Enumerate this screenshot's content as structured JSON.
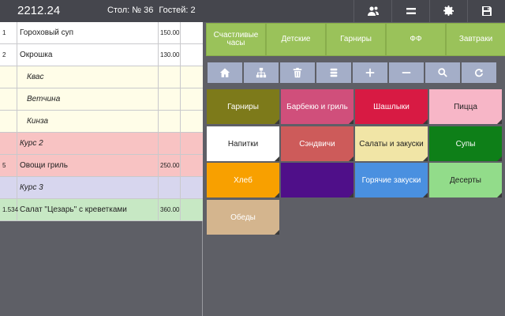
{
  "header": {
    "order_number": "2212.24",
    "table": "Стол: № 36",
    "guests": "Гостей: 2",
    "buttons": [
      {
        "icon": "users-icon"
      },
      {
        "icon": "equals-icon"
      },
      {
        "icon": "gear-icon"
      },
      {
        "icon": "save-icon"
      }
    ]
  },
  "order_rows": [
    {
      "type": "dish",
      "num": "1",
      "name": "Гороховый суп",
      "price": "150.00"
    },
    {
      "type": "dish",
      "num": "2",
      "name": "Окрошка",
      "price": "130.00"
    },
    {
      "type": "mod",
      "num": "",
      "name": "Квас",
      "price": ""
    },
    {
      "type": "mod",
      "num": "",
      "name": "Ветчина",
      "price": ""
    },
    {
      "type": "mod",
      "num": "",
      "name": "Кинза",
      "price": ""
    },
    {
      "type": "course",
      "num": "",
      "name": "Курс 2",
      "price": ""
    },
    {
      "type": "course2",
      "num": "5",
      "name": "Овощи гриль",
      "price": "250.00"
    },
    {
      "type": "course3",
      "num": "",
      "name": "Курс 3",
      "price": ""
    },
    {
      "type": "green",
      "num": "1.534",
      "name": "Салат \"Цезарь\" с креветками",
      "price": "360.00"
    }
  ],
  "categories": [
    "Счастливые часы",
    "Детские",
    "Гарниры",
    "ФФ",
    "Завтраки"
  ],
  "toolbar_icons": [
    "home-icon",
    "hierarchy-icon",
    "trash-icon",
    "stack-icon",
    "plus-icon",
    "minus-icon",
    "search-icon",
    "refresh-icon"
  ],
  "menu_tiles": [
    {
      "label": "Гарниры",
      "bg": "#7d7a1a",
      "fg": "#ffffff"
    },
    {
      "label": "Барбекю и гриль",
      "bg": "#d04f7b",
      "fg": "#ffffff"
    },
    {
      "label": "Шашлыки",
      "bg": "#d81a43",
      "fg": "#ffffff"
    },
    {
      "label": "Пицца",
      "bg": "#f7b6c7",
      "fg": "#222222"
    },
    {
      "label": "Напитки",
      "bg": "#ffffff",
      "fg": "#222222"
    },
    {
      "label": "Сэндвичи",
      "bg": "#cd5b5a",
      "fg": "#ffffff"
    },
    {
      "label": "Салаты и закуски",
      "bg": "#f1e5a6",
      "fg": "#222222"
    },
    {
      "label": "Супы",
      "bg": "#0e7f18",
      "fg": "#ffffff"
    },
    {
      "label": "Хлеб",
      "bg": "#f8a000",
      "fg": "#ffffff"
    },
    {
      "label": "",
      "bg": "#4f0f89",
      "fg": "#ffffff"
    },
    {
      "label": "Горячие закуски",
      "bg": "#4a90e0",
      "fg": "#ffffff"
    },
    {
      "label": "Десерты",
      "bg": "#92dc8a",
      "fg": "#222222"
    },
    {
      "label": "Обеды",
      "bg": "#d4b58e",
      "fg": "#ffffff"
    }
  ]
}
